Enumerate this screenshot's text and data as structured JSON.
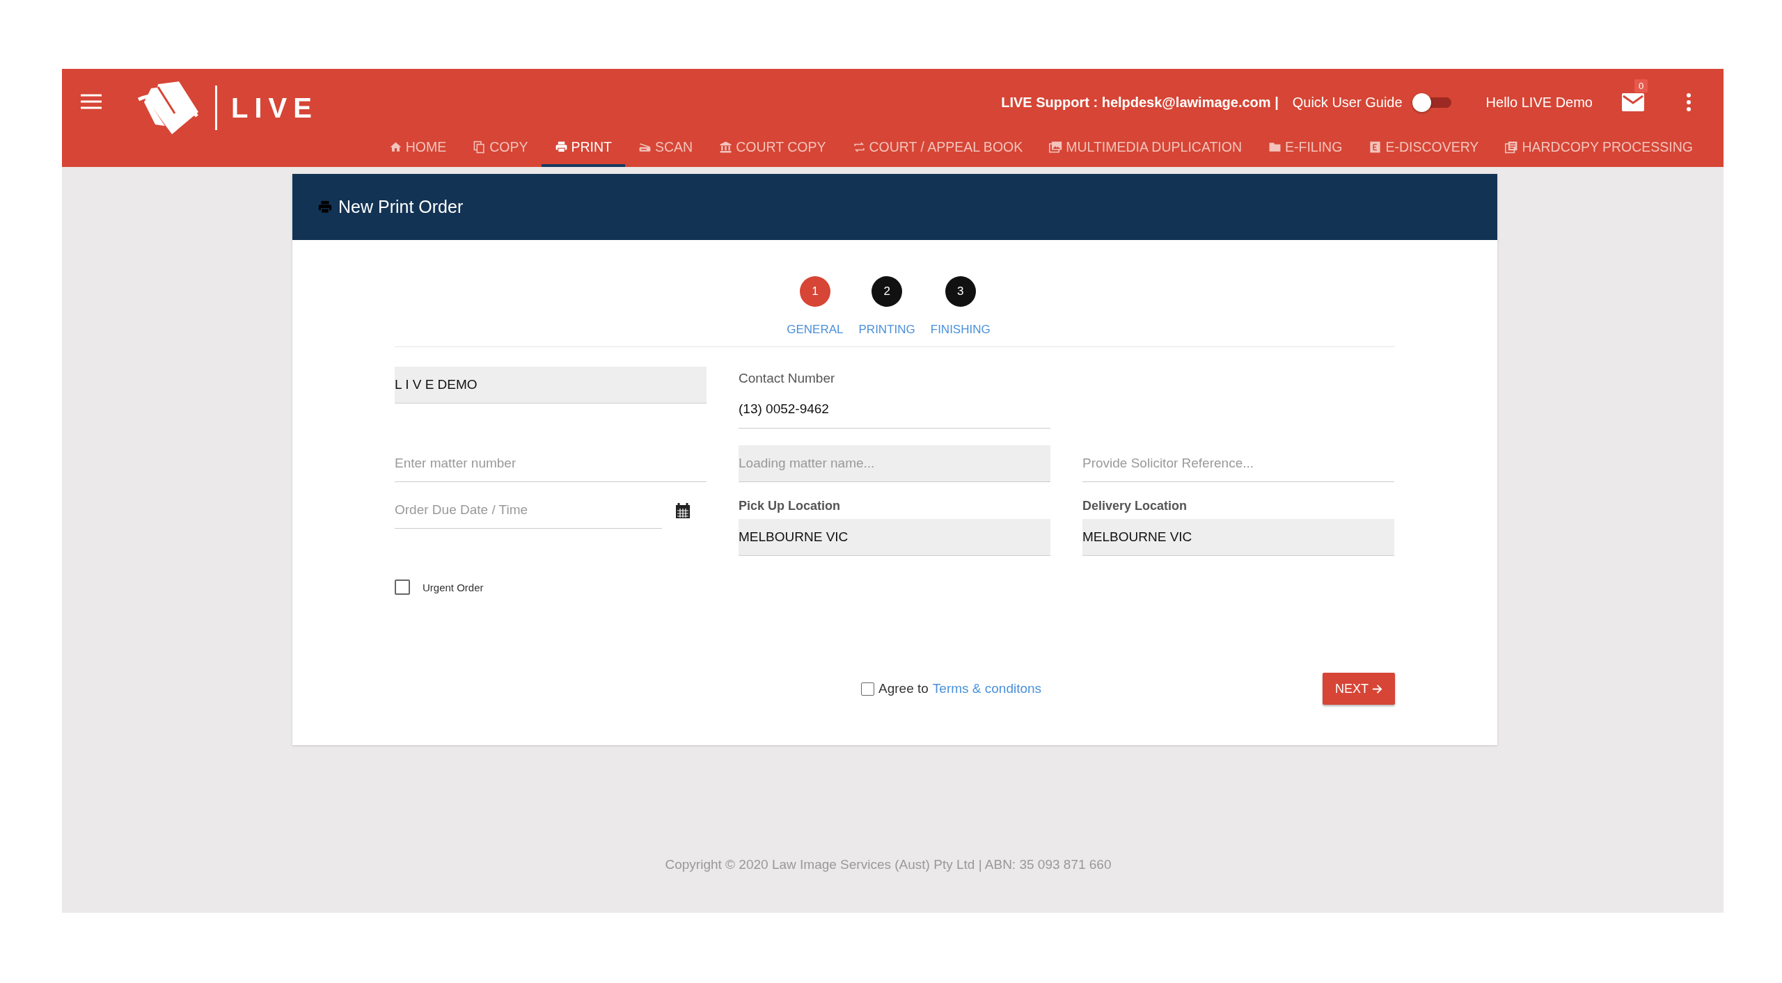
{
  "header": {
    "logo_text": "LIVE",
    "support_text": "LIVE Support : helpdesk@lawimage.com |",
    "guide_label": "Quick User Guide",
    "guide_on": false,
    "greeting": "Hello LIVE Demo",
    "mail_count": "0"
  },
  "nav": [
    {
      "label": "HOME",
      "kind": "home",
      "selected": false
    },
    {
      "label": "COPY",
      "kind": "copy",
      "selected": false
    },
    {
      "label": "PRINT",
      "kind": "print",
      "selected": true
    },
    {
      "label": "SCAN",
      "kind": "scan",
      "selected": false
    },
    {
      "label": "COURT COPY",
      "kind": "bank",
      "selected": false
    },
    {
      "label": "COURT / APPEAL BOOK",
      "kind": "repeat",
      "selected": false
    },
    {
      "label": "MULTIMEDIA DUPLICATION",
      "kind": "images",
      "selected": false
    },
    {
      "label": "E-FILING",
      "kind": "folder",
      "selected": false
    },
    {
      "label": "E-DISCOVERY",
      "kind": "ebox",
      "selected": false
    },
    {
      "label": "HARDCOPY PROCESSING",
      "kind": "doc",
      "selected": false
    }
  ],
  "card": {
    "title": "New Print Order"
  },
  "steps": [
    {
      "number": "1",
      "label": "GENERAL",
      "selected": true
    },
    {
      "number": "2",
      "label": "PRINTING",
      "selected": false
    },
    {
      "number": "3",
      "label": "FINISHING",
      "selected": false
    }
  ],
  "form_rows": [
    [
      {
        "kind": "filled",
        "value": "L I V E DEMO"
      },
      {
        "kind": "labeled",
        "label": "Contact Number",
        "value": "(13) 0052-9462"
      }
    ],
    [
      {
        "kind": "input",
        "placeholder": "Enter matter number"
      },
      {
        "kind": "readonly",
        "placeholder": "Loading matter name..."
      },
      {
        "kind": "input",
        "placeholder": "Provide Solicitor Reference..."
      }
    ],
    [
      {
        "kind": "date",
        "placeholder": "Order Due Date / Time"
      },
      {
        "kind": "labeled_filled",
        "label": "Pick Up Location",
        "value": "MELBOURNE VIC"
      },
      {
        "kind": "labeled_filled",
        "label": "Delivery Location",
        "value": "MELBOURNE VIC"
      }
    ]
  ],
  "urgent": {
    "label": "Urgent Order",
    "checked": false
  },
  "agree": {
    "text": "Agree to",
    "link": "Terms & conditons",
    "checked": false
  },
  "next_button": "NEXT",
  "footer": "Copyright © 2020 Law Image Services (Aust) Pty Ltd | ABN: 35 093 871 660"
}
